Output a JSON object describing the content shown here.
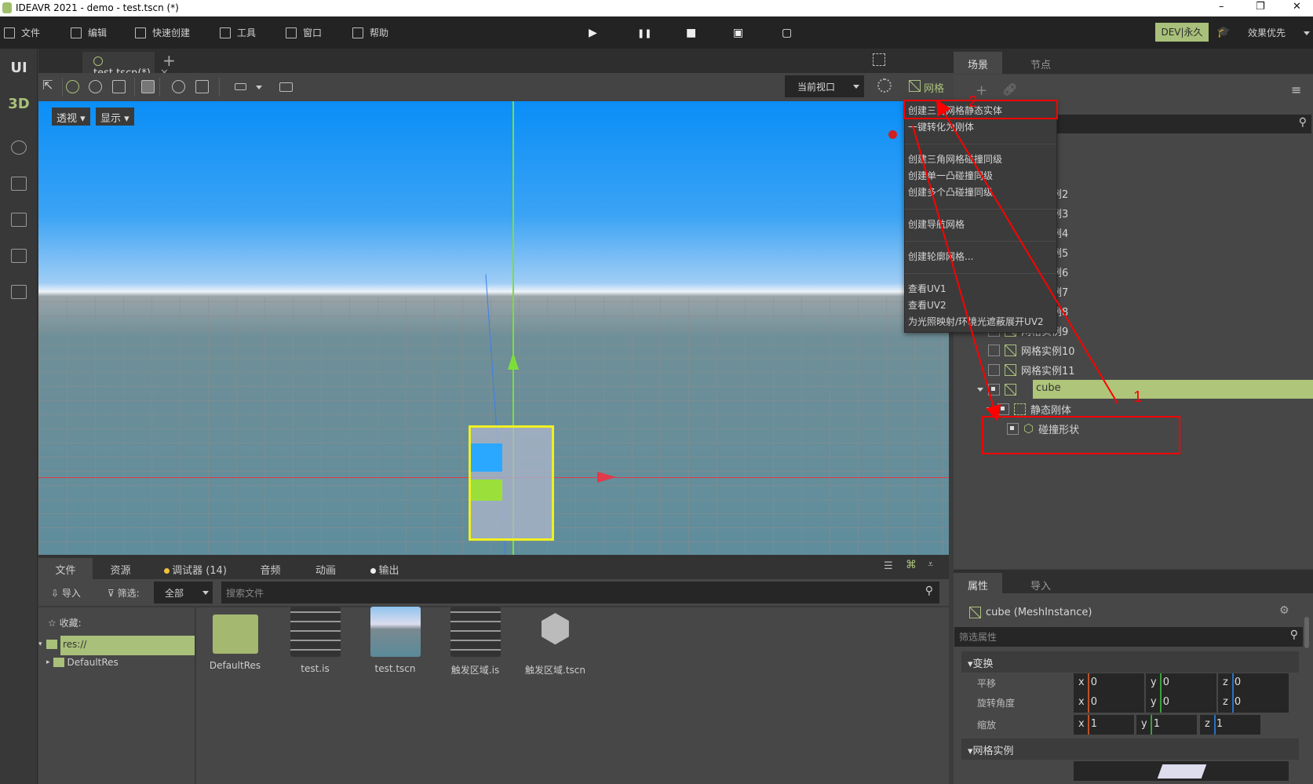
{
  "window": {
    "title": "IDEAVR 2021 - demo - test.tscn (*)",
    "controls": [
      "–",
      "❐",
      "✕"
    ]
  },
  "menu": [
    {
      "label": "文件",
      "icon": "folder-icon"
    },
    {
      "label": "编辑",
      "icon": "crop-icon"
    },
    {
      "label": "快速创建",
      "icon": "edit-icon"
    },
    {
      "label": "工具",
      "icon": "toolbox-icon"
    },
    {
      "label": "窗口",
      "icon": "window-icon"
    },
    {
      "label": "帮助",
      "icon": "book-icon"
    }
  ],
  "playback": {
    "play": "▶",
    "pause": "❚❚",
    "stop": "■",
    "play_scene": "▣",
    "play_custom": "▢"
  },
  "license": "DEV|永久",
  "quality": "效果优先",
  "sidebar": {
    "ui": "UI",
    "3d": "3D",
    "accent": "#a9c07a"
  },
  "editor_tab": {
    "label": "test.tscn(*)",
    "close": "✕",
    "add": "+"
  },
  "viewport": {
    "perspective": "透视",
    "display": "显示",
    "view_select": "当前视口",
    "mesh_menu": "网格"
  },
  "context_menu": {
    "groups": [
      [
        "创建三角网格静态实体",
        "一键转化为刚体"
      ],
      [
        "创建三角网格碰撞同级",
        "创建单一凸碰撞同级",
        "创建多个凸碰撞同级"
      ],
      [
        "创建导航网格"
      ],
      [
        "创建轮廓网格..."
      ],
      [
        "查看UV1",
        "查看UV2",
        "为光照映射/环境光遮蔽展开UV2"
      ]
    ]
  },
  "scene_panel": {
    "tabs": [
      "场景",
      "节点"
    ],
    "tree": [
      {
        "label": "网格实例2",
        "checked": false,
        "type": "mesh",
        "depth": 0
      },
      {
        "label": "网格实例3",
        "checked": false,
        "type": "mesh",
        "depth": 0
      },
      {
        "label": "网格实例4",
        "checked": false,
        "type": "mesh",
        "depth": 0
      },
      {
        "label": "网格实例5",
        "checked": false,
        "type": "mesh",
        "depth": 0
      },
      {
        "label": "网格实例6",
        "checked": false,
        "type": "mesh",
        "depth": 0
      },
      {
        "label": "网格实例7",
        "checked": false,
        "type": "mesh",
        "depth": 0
      },
      {
        "label": "网格实例8",
        "checked": false,
        "type": "mesh",
        "depth": 0
      },
      {
        "label": "网格实例9",
        "checked": false,
        "type": "mesh",
        "depth": 0
      },
      {
        "label": "网格实例10",
        "checked": false,
        "type": "mesh",
        "depth": 0
      },
      {
        "label": "网格实例11",
        "checked": false,
        "type": "mesh",
        "depth": 0
      },
      {
        "label": "cube",
        "checked": true,
        "type": "mesh",
        "depth": 0,
        "expanded": true,
        "selected": true
      },
      {
        "label": "静态刚体",
        "checked": true,
        "type": "body",
        "depth": 1,
        "expanded": true
      },
      {
        "label": "碰撞形状",
        "checked": true,
        "type": "shape",
        "depth": 2
      }
    ]
  },
  "inspector": {
    "tabs": [
      "属性",
      "导入"
    ],
    "node": "cube  (MeshInstance)",
    "filter_placeholder": "筛选属性",
    "transform": {
      "title": "变换",
      "rows": [
        {
          "label": "平移",
          "x": "0",
          "y": "0",
          "z": "0"
        },
        {
          "label": "旋转角度",
          "x": "0",
          "y": "0",
          "z": "0"
        },
        {
          "label": "缩放",
          "x": "1",
          "y": "1",
          "z": "1"
        }
      ]
    },
    "mesh_section": "网格实例"
  },
  "bottom_panel": {
    "tabs": [
      "文件",
      "资源",
      "调试器 (14)",
      "音频",
      "动画",
      "输出"
    ],
    "import": "导入",
    "filter": "筛选:",
    "filter_value": "全部",
    "search_placeholder": "搜索文件",
    "favorites": "收藏:",
    "root": "res://",
    "folder": "DefaultRes",
    "files": [
      {
        "name": "DefaultRes",
        "kind": "folder"
      },
      {
        "name": "test.is",
        "kind": "script"
      },
      {
        "name": "test.tscn",
        "kind": "scene"
      },
      {
        "name": "触发区域.is",
        "kind": "script"
      },
      {
        "name": "触发区域.tscn",
        "kind": "package"
      }
    ]
  },
  "annotations": {
    "labels": [
      "1",
      "2"
    ],
    "color": "#ff0000"
  }
}
